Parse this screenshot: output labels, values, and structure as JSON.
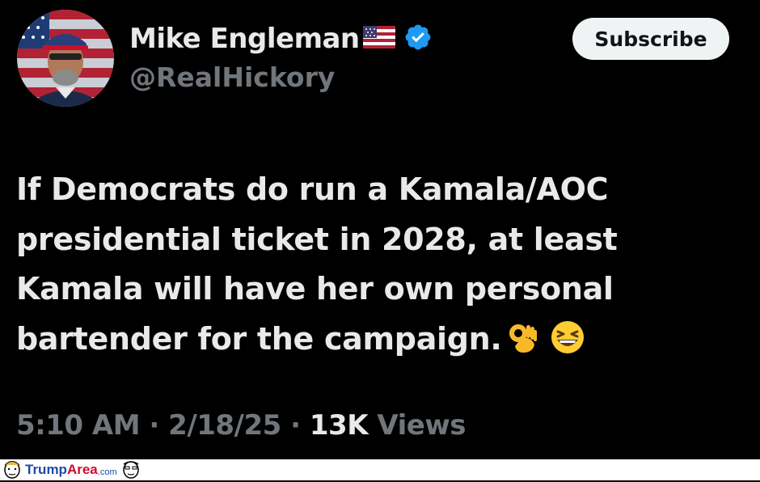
{
  "tweet": {
    "author": {
      "display_name": "Mike Engleman",
      "handle": "@RealHickory",
      "flag_icon": "us-flag-icon",
      "verified_icon": "verified-badge-icon"
    },
    "subscribe_label": "Subscribe",
    "text_lines": [
      "If Democrats do run a Kamala/AOC",
      "presidential ticket in 2028, at least",
      "Kamala will have her own personal",
      "bartender for the campaign."
    ],
    "emojis": [
      "ok-hand-emoji",
      "grinning-squinting-emoji"
    ],
    "meta": {
      "time": "5:10 AM",
      "separator": " · ",
      "date": "2/18/25",
      "views_count": "13K",
      "views_label": " Views"
    }
  },
  "watermark": {
    "brand_part1": "Trump",
    "brand_part2": "Area",
    "brand_suffix": ".com"
  },
  "colors": {
    "background": "#000000",
    "text_primary": "#e7e9ea",
    "text_secondary": "#71767b",
    "verified_blue": "#1d9bf0",
    "subscribe_bg": "#eff3f4"
  }
}
